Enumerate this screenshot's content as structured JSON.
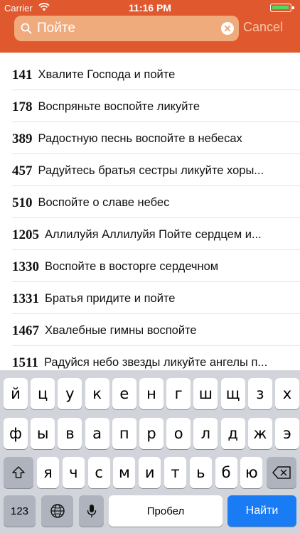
{
  "status_bar": {
    "carrier": "Carrier",
    "time": "11:16 PM"
  },
  "search": {
    "value": "Пойте",
    "cancel_label": "Cancel"
  },
  "results": [
    {
      "number": "141",
      "title": "Хвалите Господа и пойте"
    },
    {
      "number": "178",
      "title": "Воспряньте воспойте ликуйте"
    },
    {
      "number": "389",
      "title": "Радостную песнь воспойте в небесах"
    },
    {
      "number": "457",
      "title": "Радуйтесь братья сестры ликуйте хоры..."
    },
    {
      "number": "510",
      "title": "Воспойте о славе небес"
    },
    {
      "number": "1205",
      "title": "Аллилуйя Аллилуйя Пойте сердцем и..."
    },
    {
      "number": "1330",
      "title": "Воспойте в восторге сердечном"
    },
    {
      "number": "1331",
      "title": "Братья придите и пойте"
    },
    {
      "number": "1467",
      "title": "Хвалебные гимны воспойте"
    },
    {
      "number": "1511",
      "title": "Радуйся небо звезды ликуйте ангелы п..."
    }
  ],
  "keyboard": {
    "row1": [
      "й",
      "ц",
      "у",
      "к",
      "е",
      "н",
      "г",
      "ш",
      "щ",
      "з",
      "х"
    ],
    "row2": [
      "ф",
      "ы",
      "в",
      "а",
      "п",
      "р",
      "о",
      "л",
      "д",
      "ж",
      "э"
    ],
    "row3": [
      "я",
      "ч",
      "с",
      "м",
      "и",
      "т",
      "ь",
      "б",
      "ю"
    ],
    "numbers_label": "123",
    "space_label": "Пробел",
    "return_label": "Найти"
  },
  "colors": {
    "header": "#e0592e",
    "return_key": "#1a7cf5",
    "battery": "#4cd964"
  }
}
